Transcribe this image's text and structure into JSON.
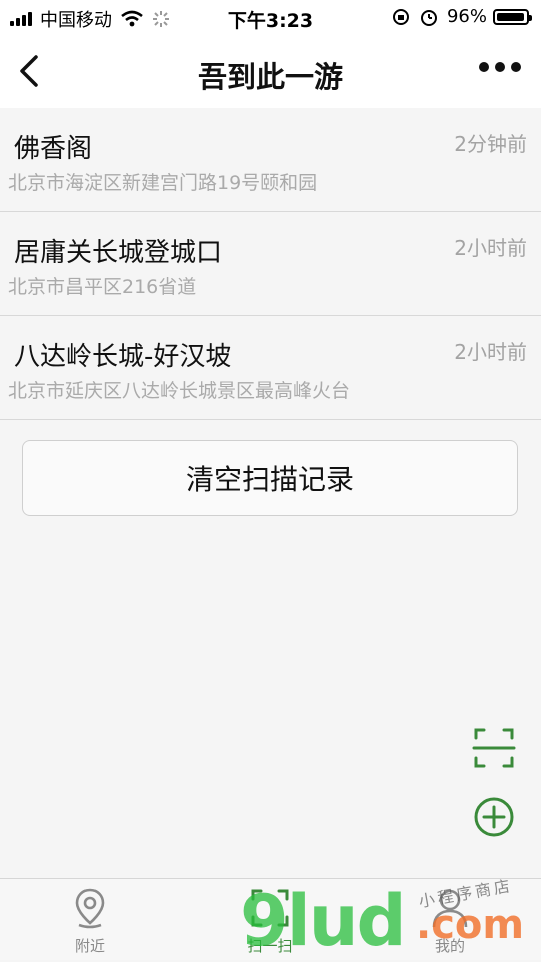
{
  "status_bar": {
    "carrier": "中国移动",
    "time": "下午3:23",
    "battery": "96%"
  },
  "nav": {
    "title": "吾到此一游"
  },
  "records": [
    {
      "name": "佛香阁",
      "address": "北京市海淀区新建宫门路19号颐和园",
      "time": "2分钟前"
    },
    {
      "name": "居庸关长城登城口",
      "address": "北京市昌平区216省道",
      "time": "2小时前"
    },
    {
      "name": "八达岭长城-好汉坡",
      "address": "北京市延庆区八达岭长城景区最高峰火台",
      "time": "2小时前"
    }
  ],
  "clear_button": {
    "label": "清空扫描记录"
  },
  "tabs": [
    {
      "label": "附近",
      "icon": "location-pin-icon"
    },
    {
      "label": "扫一扫",
      "icon": "scan-icon"
    },
    {
      "label": "我的",
      "icon": "user-icon"
    }
  ],
  "watermark": {
    "main": "9lud",
    "com": ".com",
    "sub": "小程序商店"
  },
  "colors": {
    "accent_green": "#3a8a3a",
    "muted_gray": "#a3a3a3"
  }
}
